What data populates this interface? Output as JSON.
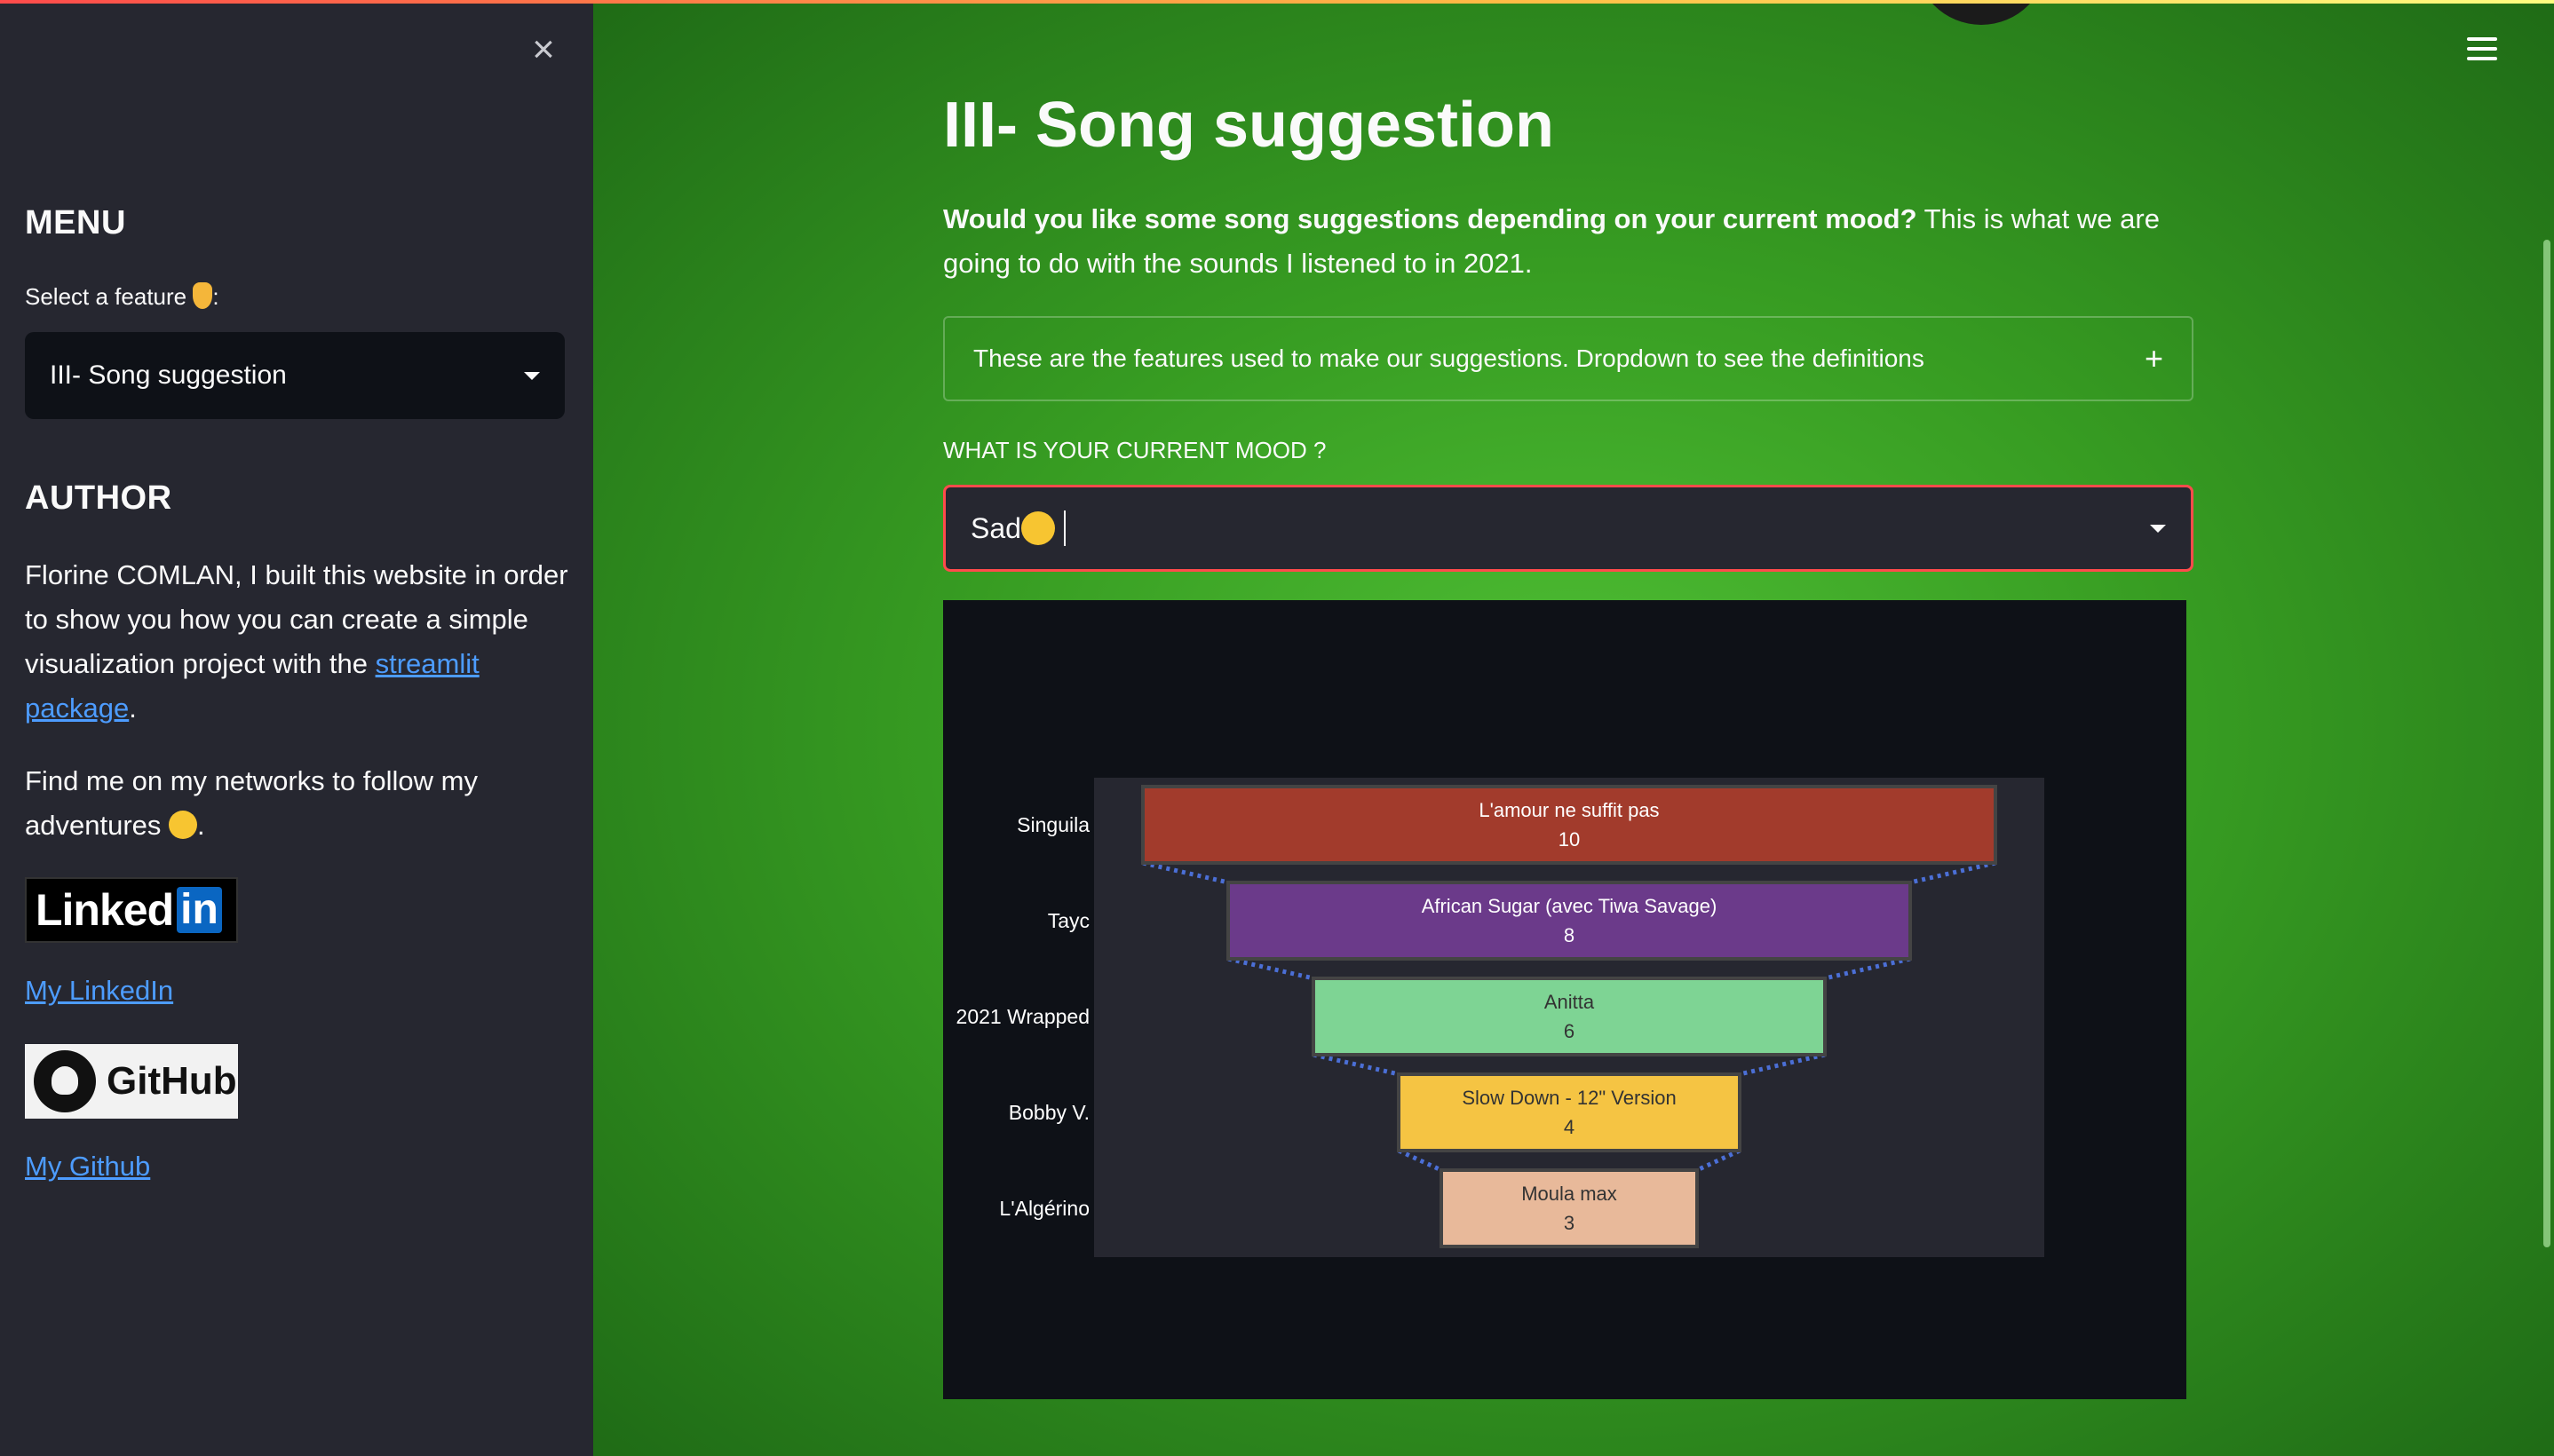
{
  "sidebar": {
    "menu_heading": "MENU",
    "select_label": "Select a feature",
    "select_label_suffix": ":",
    "feature_value": "III- Song suggestion",
    "author_heading": "AUTHOR",
    "author_text_1": "Florine COMLAN, I built this website in order to show you how you can create a simple visualization project with the ",
    "author_link": "streamlit package",
    "author_text_2": ".",
    "networks_text": "Find me on my networks to follow my adventures ",
    "networks_suffix": ".",
    "linkedin_badge_text": "Linked",
    "linkedin_badge_in": "in",
    "linkedin_link": "My LinkedIn",
    "github_badge_text": "GitHub",
    "github_link": "My Github"
  },
  "main": {
    "title": "III- Song suggestion",
    "intro_bold": "Would you like some song suggestions depending on your current mood?",
    "intro_rest": " This is what we are going to do with the sounds I listened to in 2021.",
    "expander_label": "These are the features used to make our suggestions. Dropdown to see the definitions",
    "expander_icon": "+",
    "mood_label": "WHAT IS YOUR CURRENT MOOD ?",
    "mood_value": "Sad"
  },
  "colors": {
    "sidebar_bg": "#262730",
    "accent_red": "#ff4b4b",
    "link_blue": "#4d9cff"
  },
  "chart_data": {
    "type": "funnel",
    "categories": [
      "Singuila",
      "Tayc",
      "2021 Wrapped",
      "Bobby V.",
      "L'Algérino"
    ],
    "labels": [
      "L'amour ne suffit pas",
      "African Sugar (avec Tiwa Savage)",
      "Anitta",
      "Slow Down - 12\" Version",
      "Moula max"
    ],
    "values": [
      10,
      8,
      6,
      4,
      3
    ],
    "colors": [
      "#a23b2c",
      "#6b3a8a",
      "#7ed494",
      "#f5c443",
      "#e8b99a"
    ]
  }
}
